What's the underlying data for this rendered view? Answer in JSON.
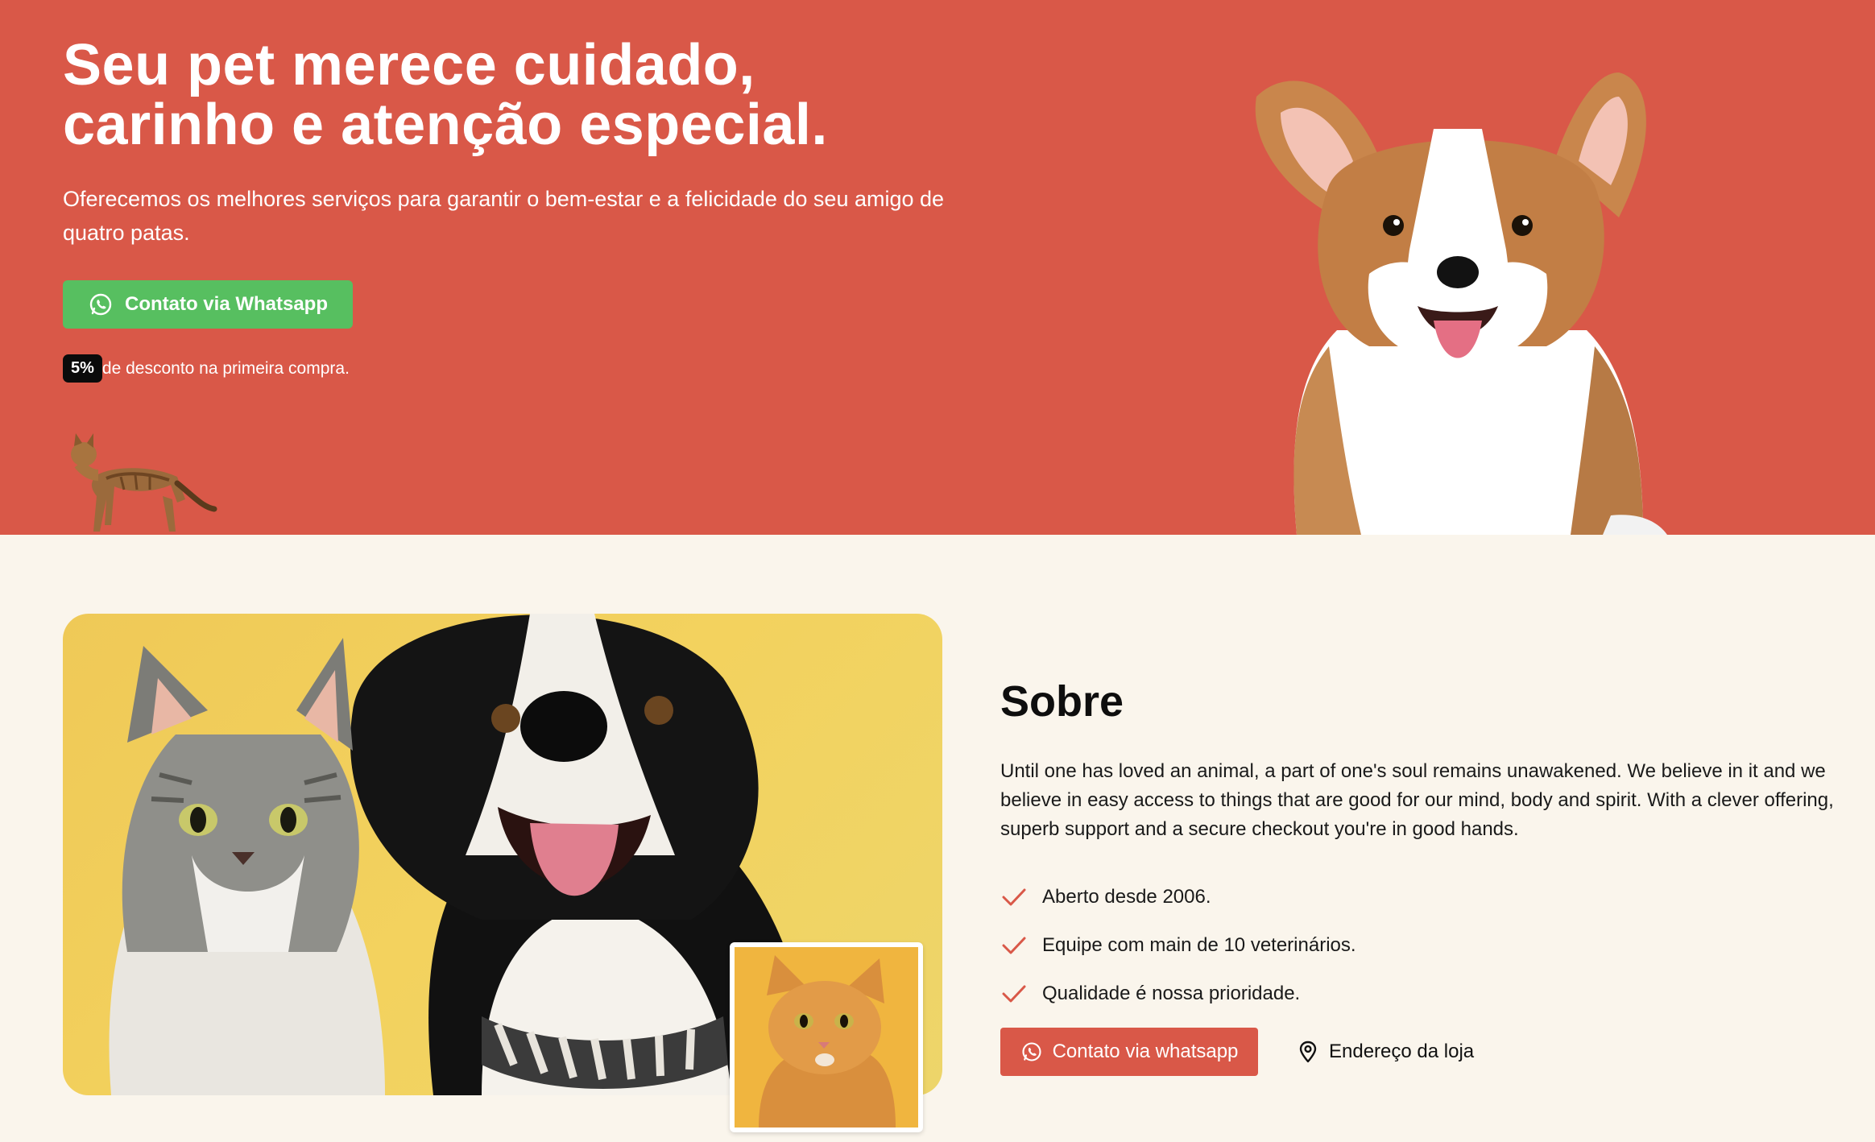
{
  "hero": {
    "title_line1": "Seu pet merece cuidado,",
    "title_line2": "carinho e atenção especial.",
    "subtitle": "Oferecemos os melhores serviços para garantir o bem-estar e a felicidade do seu amigo de quatro patas.",
    "cta_label": "Contato via Whatsapp",
    "discount_badge": "5%",
    "discount_text": "de desconto na primeira compra.",
    "background_color": "#d95848",
    "cta_color": "#57bf60"
  },
  "about": {
    "title": "Sobre",
    "text": "Until one has loved an animal, a part of one's soul remains unawakened. We believe in it and we believe in easy access to things that are good for our mind, body and spirit. With a clever offering, superb support and a secure checkout you're in good hands.",
    "features": [
      "Aberto desde 2006.",
      "Equipe com main de 10 veterinários.",
      "Qualidade é nossa prioridade."
    ],
    "cta_label": "Contato via whatsapp",
    "address_label": "Endereço da loja",
    "background_color": "#faf5ec",
    "accent_color": "#d95848"
  },
  "icons": {
    "whatsapp": "whatsapp-icon",
    "check": "check-icon",
    "location": "map-pin-icon"
  }
}
